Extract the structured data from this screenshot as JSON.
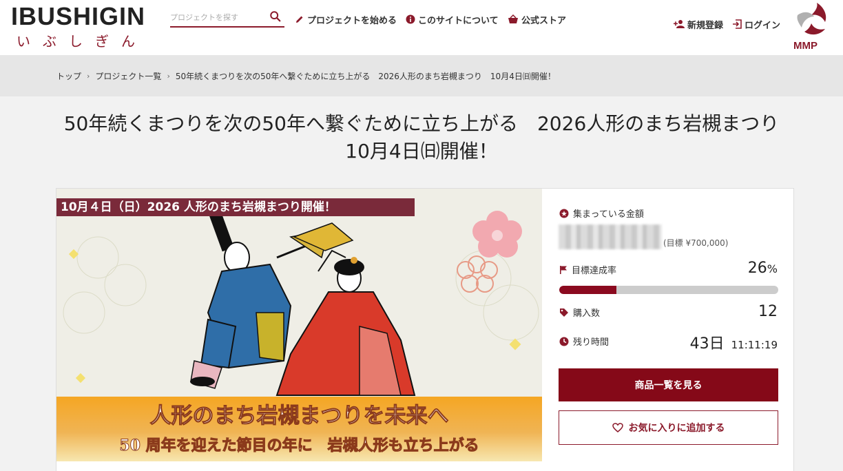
{
  "header": {
    "logo_text": "IBUSHIGIN",
    "logo_sub": "いぶしぎん",
    "search_placeholder": "プロジェクトを探す",
    "nav": [
      {
        "label": "プロジェクトを始める",
        "icon": "pencil-icon"
      },
      {
        "label": "このサイトについて",
        "icon": "info-icon"
      },
      {
        "label": "公式ストア",
        "icon": "basket-icon"
      }
    ],
    "register_label": "新規登録",
    "login_label": "ログイン",
    "mmp_label": "MMP"
  },
  "breadcrumb": {
    "items": [
      "トップ",
      "プロジェクト一覧",
      "50年続くまつりを次の50年へ繋ぐために立ち上がる　2026人形のまち岩槻まつり　10月4日㈰開催！"
    ]
  },
  "project": {
    "title": "50年続くまつりを次の50年へ繋ぐために立ち上がる　2026人形のまち岩槻まつり　10月4日㈰開催！",
    "hero": {
      "banner_top": "10月４日（日）2026 人形のまち岩槻まつり開催！",
      "line1": "人形のまち岩槻まつりを未来へ",
      "line2": "50 周年を迎えた節目の年に　岩槻人形も立ち上がる"
    }
  },
  "stats": {
    "amount_label": "集まっている金額",
    "goal": "(目標 ¥700,000)",
    "rate_label": "目標達成率",
    "rate_value": "26",
    "rate_unit": "%",
    "progress_fraction": 0.26,
    "purchases_label": "購入数",
    "purchases_value": "12",
    "remaining_label": "残り時間",
    "remaining_days": "43日",
    "remaining_time": "11:11:19",
    "view_items_button": "商品一覧を見る",
    "favorite_button": "お気に入りに追加する"
  },
  "colors": {
    "brand": "#850918",
    "progress_track": "#cccccc"
  }
}
